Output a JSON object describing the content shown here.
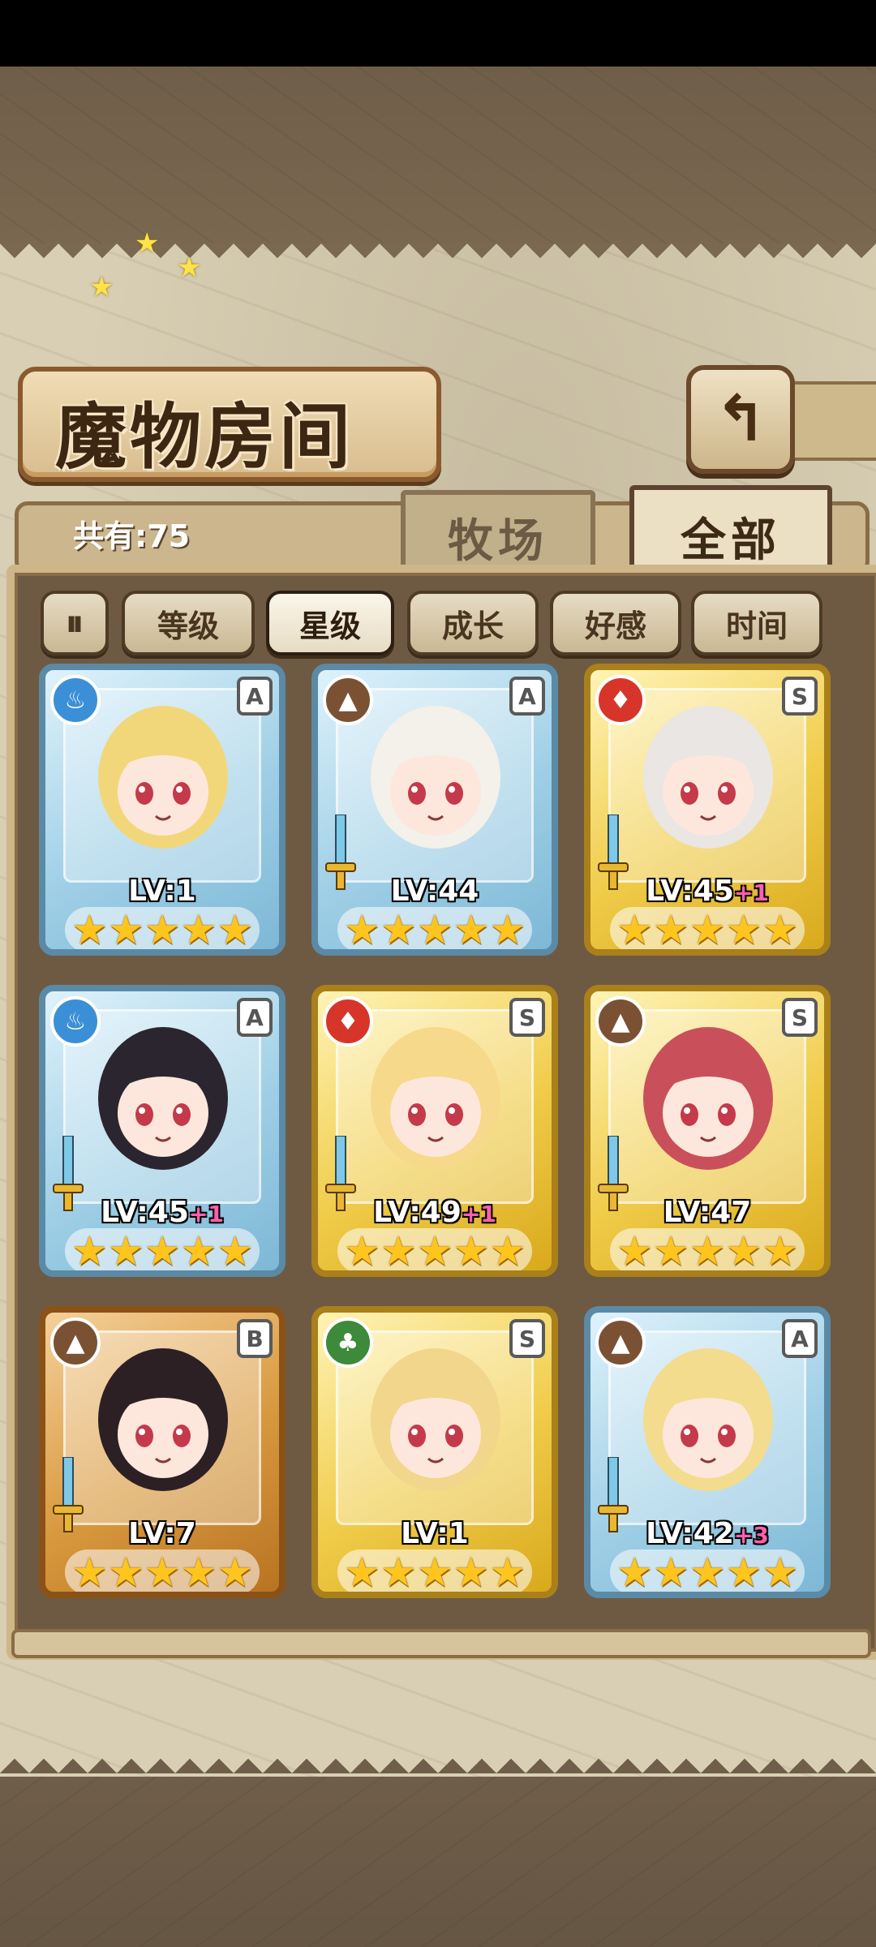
{
  "header": {
    "title": "魔物房间",
    "back_icon": "↰"
  },
  "filter": {
    "count": "共有:75",
    "tabs": [
      {
        "label": "牧场",
        "active": false
      },
      {
        "label": "全部",
        "active": true
      }
    ]
  },
  "sort": {
    "toggle_icon": "⏸",
    "buttons": [
      {
        "label": "等级",
        "active": false
      },
      {
        "label": "星级",
        "active": true
      },
      {
        "label": "成长",
        "active": false
      },
      {
        "label": "好感",
        "active": false
      },
      {
        "label": "时间",
        "active": false
      }
    ]
  },
  "monsters": [
    {
      "element": "water",
      "element_icon": "♨",
      "rank": "A",
      "level": "LV:1",
      "bonus": "",
      "stars": 5,
      "portrait_color": "#f2d77a"
    },
    {
      "element": "earth",
      "element_icon": "▲",
      "rank": "A",
      "level": "LV:44",
      "bonus": "",
      "stars": 5,
      "portrait_color": "#f4f0ea"
    },
    {
      "element": "fire",
      "element_icon": "♦",
      "rank": "S",
      "level": "LV:45",
      "bonus": "+1",
      "stars": 5,
      "portrait_color": "#e9e6e3"
    },
    {
      "element": "water",
      "element_icon": "♨",
      "rank": "A",
      "level": "LV:45",
      "bonus": "+1",
      "stars": 5,
      "portrait_color": "#2b2530"
    },
    {
      "element": "fire",
      "element_icon": "♦",
      "rank": "S",
      "level": "LV:49",
      "bonus": "+1",
      "stars": 5,
      "portrait_color": "#f6d98a"
    },
    {
      "element": "earth",
      "element_icon": "▲",
      "rank": "S",
      "level": "LV:47",
      "bonus": "",
      "stars": 5,
      "portrait_color": "#c9505a"
    },
    {
      "element": "earth",
      "element_icon": "▲",
      "rank": "B",
      "level": "LV:7",
      "bonus": "",
      "stars": 5,
      "portrait_color": "#2c2024"
    },
    {
      "element": "leaf",
      "element_icon": "♣",
      "rank": "S",
      "level": "LV:1",
      "bonus": "",
      "stars": 5,
      "portrait_color": "#f1d68c"
    },
    {
      "element": "earth",
      "element_icon": "▲",
      "rank": "A",
      "level": "LV:42",
      "bonus": "+3",
      "stars": 5,
      "portrait_color": "#f3dc8e"
    }
  ],
  "colors": {
    "rank_A": "#7db8d6",
    "rank_S": "#d9a91c",
    "rank_B": "#b97322",
    "star": "#ffc51f",
    "bonus": "#ff5fae"
  }
}
